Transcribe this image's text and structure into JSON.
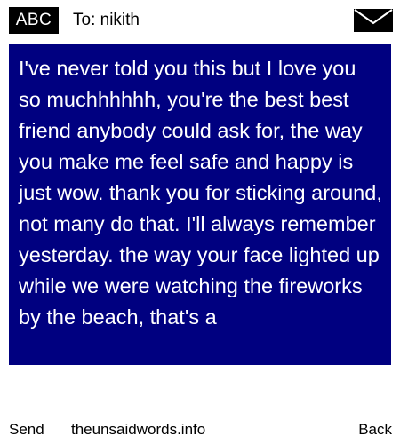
{
  "header": {
    "input_mode": "ABC",
    "recipient_label": "To: nikith",
    "mail_icon": "envelope-icon"
  },
  "message": {
    "body": "I've never told you this but I love you so muchhhhhh, you're the best best friend anybody could ask for, the way you make me feel safe and happy is just wow. thank you for sticking around, not many do that. I'll always remember yesterday. the way your face lighted up while we were watching the fireworks by the beach, that's a"
  },
  "footer": {
    "left_softkey": "Send",
    "site": "theunsaidwords.info",
    "right_softkey": "Back"
  },
  "colors": {
    "panel_background": "#000080",
    "panel_text": "#ffffff",
    "badge_background": "#000000"
  }
}
